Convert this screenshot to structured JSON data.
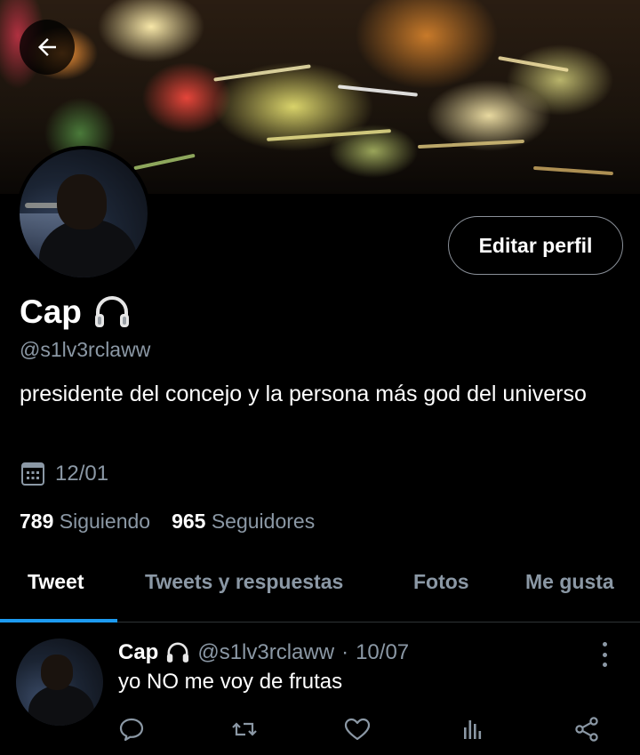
{
  "profile": {
    "name": "Cap",
    "handle": "@s1lv3rclaww",
    "bio": "presidente del concejo y la persona más god del universo",
    "joined_date": "12/01",
    "edit_button_label": "Editar perfil",
    "name_emoji_icon": "headphones-icon"
  },
  "stats": {
    "following_count": "789",
    "following_label": "Siguiendo",
    "followers_count": "965",
    "followers_label": "Seguidores"
  },
  "tabs": [
    {
      "label": "Tweet",
      "active": true
    },
    {
      "label": "Tweets y respuestas",
      "active": false
    },
    {
      "label": "Fotos",
      "active": false
    },
    {
      "label": "Me gusta",
      "active": false
    }
  ],
  "tweet": {
    "author_name": "Cap",
    "author_handle": "@s1lv3rclaww",
    "separator": "·",
    "date": "10/07",
    "text": "yo NO me voy de frutas",
    "actions": [
      "reply-icon",
      "retweet-icon",
      "like-icon",
      "analytics-icon",
      "share-icon"
    ]
  },
  "colors": {
    "background": "#000000",
    "accent": "#1d9bf0",
    "secondary_text": "#8b98a5"
  }
}
